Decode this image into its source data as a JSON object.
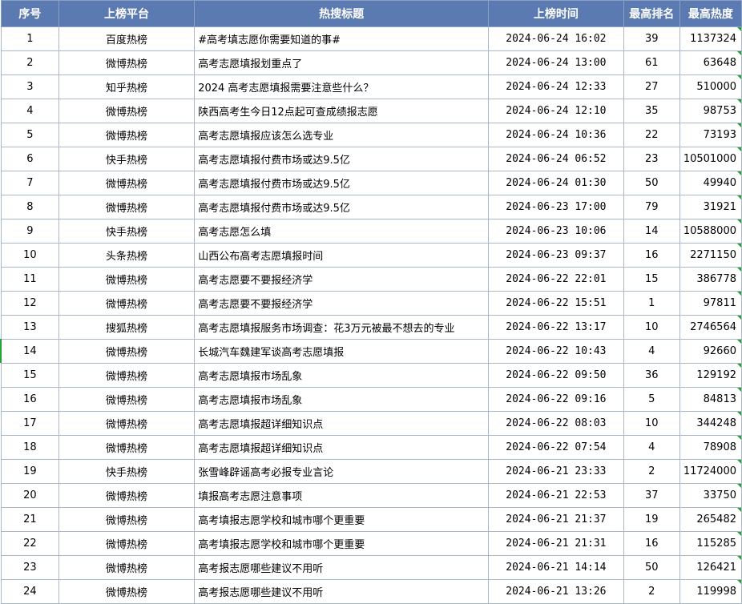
{
  "headers": [
    "序号",
    "上榜平台",
    "热搜标题",
    "上榜时间",
    "最高排名",
    "最高热度"
  ],
  "rows": [
    {
      "idx": "1",
      "platform": "百度热榜",
      "title": "#高考填志愿你需要知道的事#",
      "time": "2024-06-24  16:02",
      "rank": "39",
      "heat": "1137324"
    },
    {
      "idx": "2",
      "platform": "微博热榜",
      "title": "高考志愿填报划重点了",
      "time": "2024-06-24  13:00",
      "rank": "61",
      "heat": "63648"
    },
    {
      "idx": "3",
      "platform": "知乎热榜",
      "title": "2024 高考志愿填报需要注意些什么？",
      "time": "2024-06-24  12:33",
      "rank": "27",
      "heat": "510000"
    },
    {
      "idx": "4",
      "platform": "微博热榜",
      "title": "陕西高考生今日12点起可查成绩报志愿",
      "time": "2024-06-24  12:10",
      "rank": "35",
      "heat": "98753"
    },
    {
      "idx": "5",
      "platform": "微博热榜",
      "title": "高考志愿填报应该怎么选专业",
      "time": "2024-06-24  10:36",
      "rank": "22",
      "heat": "73193"
    },
    {
      "idx": "6",
      "platform": "快手热榜",
      "title": "高考志愿填报付费市场或达9.5亿",
      "time": "2024-06-24  06:52",
      "rank": "23",
      "heat": "10501000"
    },
    {
      "idx": "7",
      "platform": "微博热榜",
      "title": "高考志愿填报付费市场或达9.5亿",
      "time": "2024-06-24  01:30",
      "rank": "50",
      "heat": "49940"
    },
    {
      "idx": "8",
      "platform": "微博热榜",
      "title": "高考志愿填报付费市场或达9.5亿",
      "time": "2024-06-23  17:00",
      "rank": "79",
      "heat": "31921"
    },
    {
      "idx": "9",
      "platform": "快手热榜",
      "title": "高考志愿怎么填",
      "time": "2024-06-23  10:06",
      "rank": "14",
      "heat": "10588000"
    },
    {
      "idx": "10",
      "platform": "头条热榜",
      "title": "山西公布高考志愿填报时间",
      "time": "2024-06-23  09:37",
      "rank": "16",
      "heat": "2271150"
    },
    {
      "idx": "11",
      "platform": "微博热榜",
      "title": "高考志愿要不要报经济学",
      "time": "2024-06-22  22:01",
      "rank": "15",
      "heat": "386778"
    },
    {
      "idx": "12",
      "platform": "微博热榜",
      "title": "高考志愿要不要报经济学",
      "time": "2024-06-22  15:51",
      "rank": "1",
      "heat": "97811"
    },
    {
      "idx": "13",
      "platform": "搜狐热榜",
      "title": "高考志愿填报服务市场调查：花3万元被最不想去的专业",
      "time": "2024-06-22  13:17",
      "rank": "10",
      "heat": "2746564"
    },
    {
      "idx": "14",
      "platform": "微博热榜",
      "title": "长城汽车魏建军谈高考志愿填报",
      "time": "2024-06-22  10:43",
      "rank": "4",
      "heat": "92660"
    },
    {
      "idx": "15",
      "platform": "微博热榜",
      "title": "高考志愿填报市场乱象",
      "time": "2024-06-22  09:50",
      "rank": "36",
      "heat": "129192"
    },
    {
      "idx": "16",
      "platform": "微博热榜",
      "title": "高考志愿填报市场乱象",
      "time": "2024-06-22  09:16",
      "rank": "5",
      "heat": "84813"
    },
    {
      "idx": "17",
      "platform": "微博热榜",
      "title": "高考志愿填报超详细知识点",
      "time": "2024-06-22  08:03",
      "rank": "10",
      "heat": "344248"
    },
    {
      "idx": "18",
      "platform": "微博热榜",
      "title": "高考志愿填报超详细知识点",
      "time": "2024-06-22  07:54",
      "rank": "4",
      "heat": "78908"
    },
    {
      "idx": "19",
      "platform": "快手热榜",
      "title": "张雪峰辟谣高考必报专业言论",
      "time": "2024-06-21  23:33",
      "rank": "2",
      "heat": "11724000"
    },
    {
      "idx": "20",
      "platform": "微博热榜",
      "title": "填报高考志愿注意事项",
      "time": "2024-06-21  22:53",
      "rank": "37",
      "heat": "33750"
    },
    {
      "idx": "21",
      "platform": "微博热榜",
      "title": "高考填报志愿学校和城市哪个更重要",
      "time": "2024-06-21  21:37",
      "rank": "19",
      "heat": "265482"
    },
    {
      "idx": "22",
      "platform": "微博热榜",
      "title": "高考填报志愿学校和城市哪个更重要",
      "time": "2024-06-21  21:31",
      "rank": "16",
      "heat": "115285"
    },
    {
      "idx": "23",
      "platform": "微博热榜",
      "title": "高考报志愿哪些建议不用听",
      "time": "2024-06-21  14:14",
      "rank": "50",
      "heat": "126421"
    },
    {
      "idx": "24",
      "platform": "微博热榜",
      "title": "高考报志愿哪些建议不用听",
      "time": "2024-06-21  13:26",
      "rank": "2",
      "heat": "119998"
    }
  ],
  "colors": {
    "header_bg": "#5b7ab1",
    "header_text": "#ffffff",
    "grid": "#a9b7c6",
    "comment_marker": "#22a33a"
  }
}
